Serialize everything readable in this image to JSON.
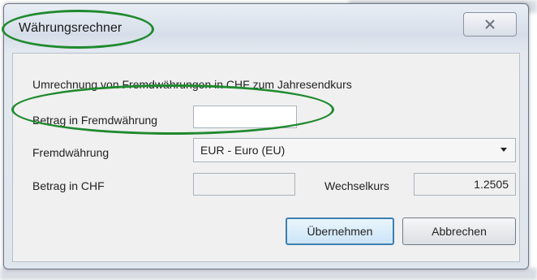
{
  "window": {
    "title": "Währungsrechner",
    "close_icon": "close-icon"
  },
  "form": {
    "description": "Umrechnung von Fremdwährungen in CHF zum Jahresendkurs",
    "amount_foreign_label": "Betrag in Fremdwährung",
    "amount_foreign_value": "",
    "currency_label": "Fremdwährung",
    "currency_selected": "EUR - Euro (EU)",
    "amount_chf_label": "Betrag in CHF",
    "amount_chf_value": "",
    "rate_label": "Wechselkurs",
    "rate_value": "1.2505"
  },
  "buttons": {
    "apply_label": "Übernehmen",
    "cancel_label": "Abbrechen"
  },
  "colors": {
    "annotation": "#1f8a2e",
    "default_button_border": "#3c7fb1"
  }
}
